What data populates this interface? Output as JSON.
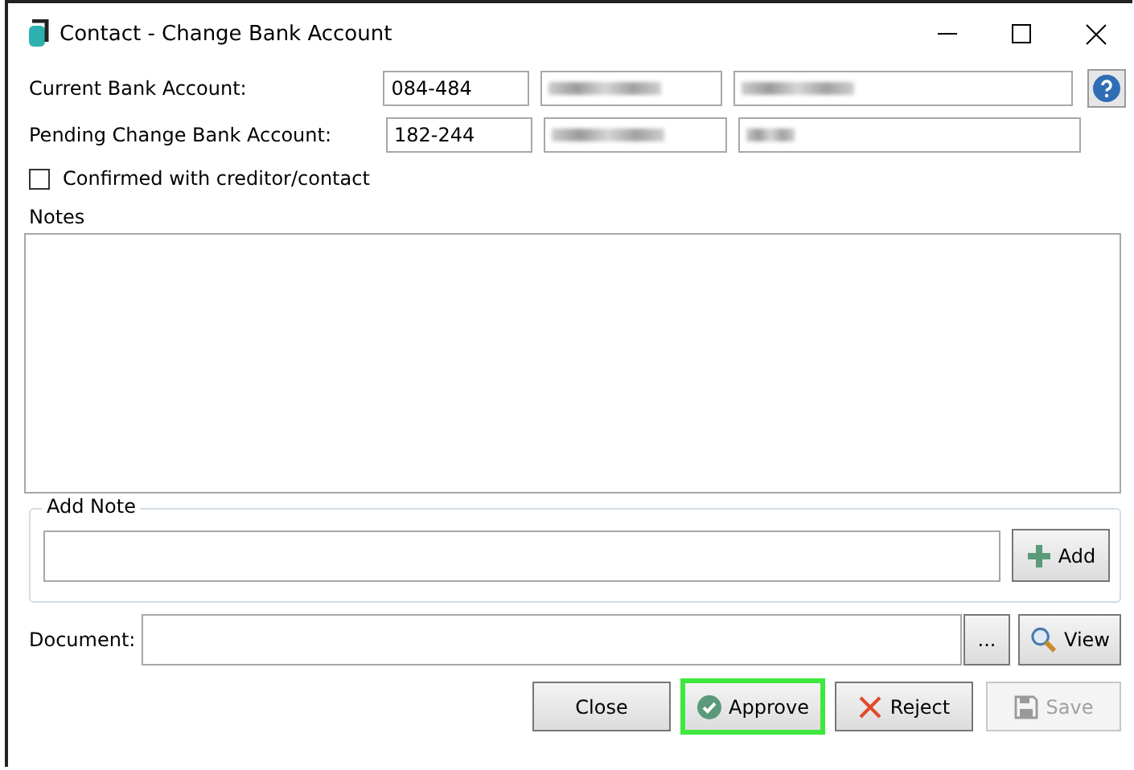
{
  "window": {
    "title": "Contact - Change Bank Account"
  },
  "accounts": [
    {
      "label": "Current Bank Account:",
      "code": "084-484",
      "name_redacted": true,
      "number_redacted": true
    },
    {
      "label": "Pending Change Bank Account:",
      "code": "182-244",
      "name_redacted": true,
      "number_redacted": true
    }
  ],
  "confirmed": {
    "label": "Confirmed with creditor/contact",
    "checked": false
  },
  "notes": {
    "label": "Notes"
  },
  "add_note": {
    "label": "Add Note",
    "button": "Add"
  },
  "document": {
    "label": "Document:",
    "browse": "...",
    "view": "View"
  },
  "buttons": [
    {
      "kind": "close",
      "label": "Close",
      "disabled": false,
      "highlighted": false
    },
    {
      "kind": "approve",
      "label": "Approve",
      "disabled": false,
      "highlighted": true
    },
    {
      "kind": "reject",
      "label": "Reject",
      "disabled": false,
      "highlighted": false
    },
    {
      "kind": "save",
      "label": "Save",
      "disabled": true,
      "highlighted": false
    }
  ]
}
